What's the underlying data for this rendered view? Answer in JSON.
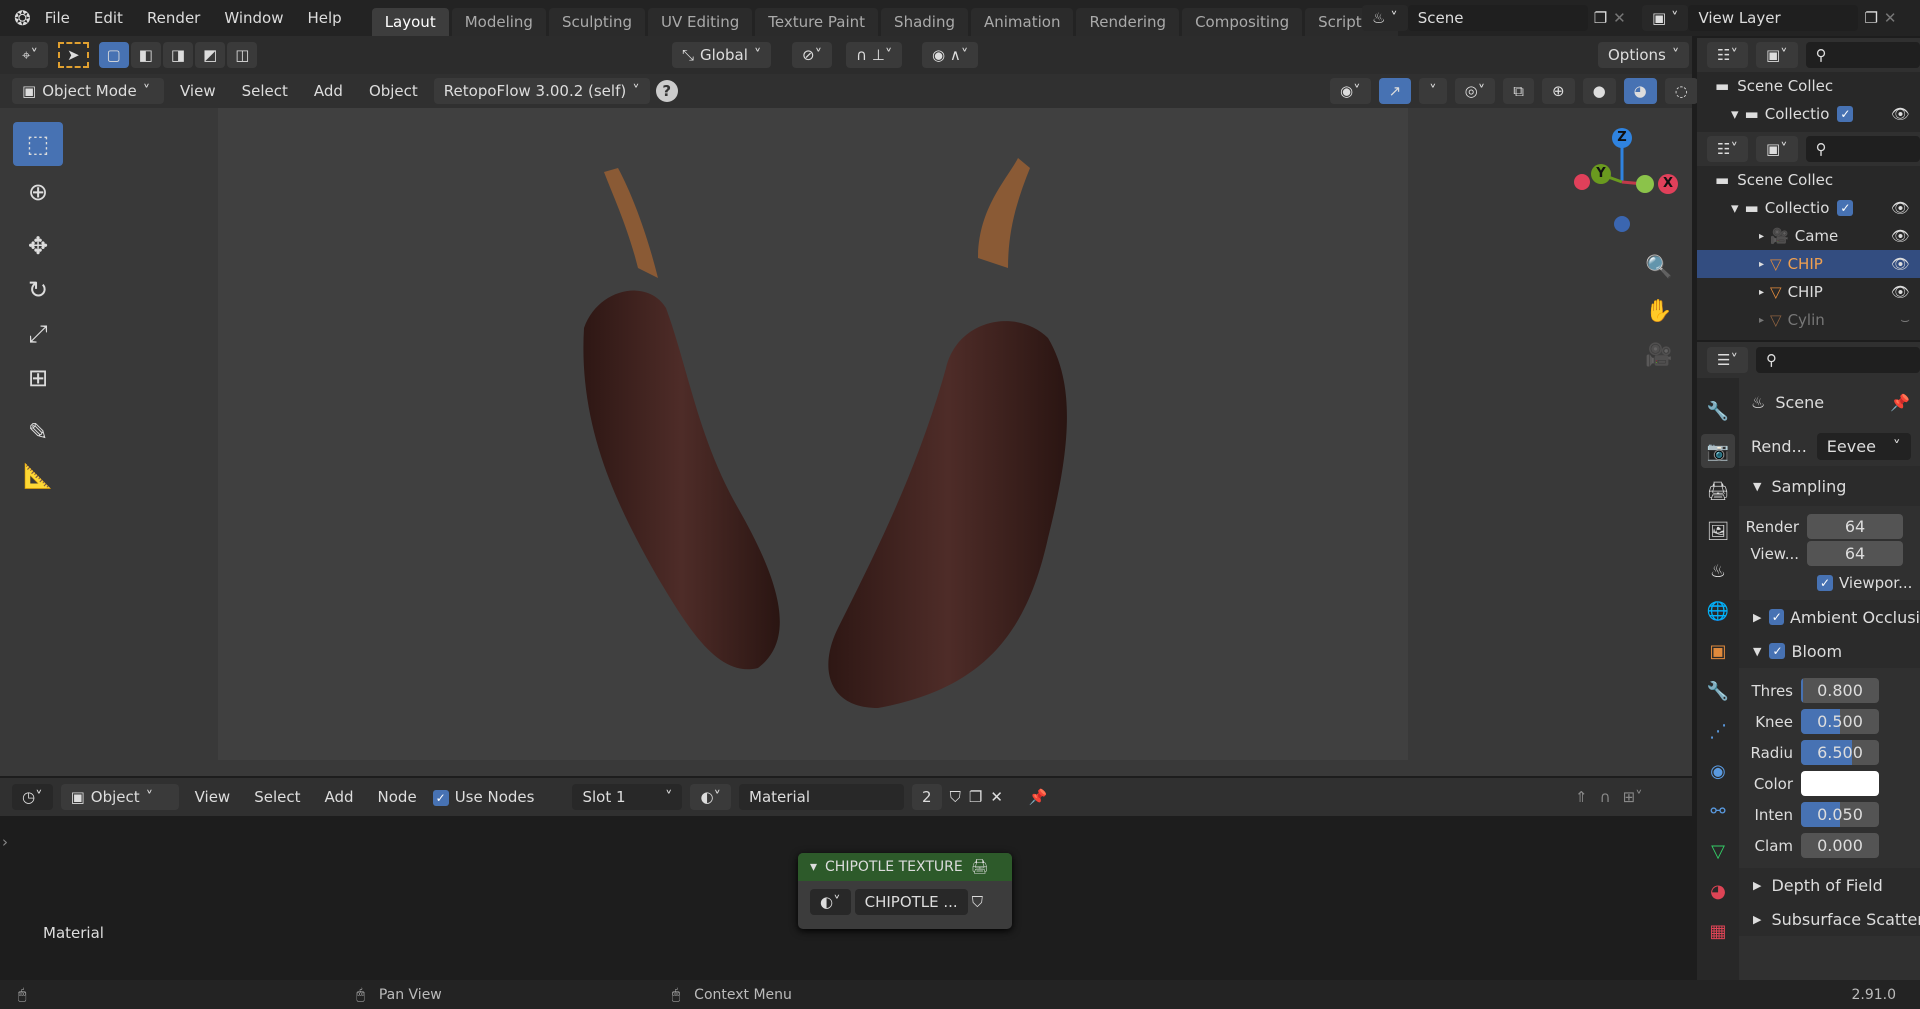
{
  "menu": {
    "items": [
      "File",
      "Edit",
      "Render",
      "Window",
      "Help"
    ]
  },
  "workspaces": [
    "Layout",
    "Modeling",
    "Sculpting",
    "UV Editing",
    "Texture Paint",
    "Shading",
    "Animation",
    "Rendering",
    "Compositing",
    "Scripting"
  ],
  "add_tab": "+",
  "scene": {
    "name": "Scene",
    "view_layer": "View Layer"
  },
  "tool_header": {
    "orientation": "Global",
    "options": "Options"
  },
  "viewport_header": {
    "mode": "Object Mode",
    "menus": [
      "View",
      "Select",
      "Add",
      "Object"
    ],
    "addon": "RetopoFlow 3.00.2 (self)",
    "help": "?"
  },
  "gizmo": {
    "z": "Z",
    "y": "Y",
    "x": "X"
  },
  "outliner": {
    "top": {
      "root": "Scene Collec",
      "collection": "Collectio"
    },
    "bottom": {
      "root": "Scene Collec",
      "collection": "Collectio",
      "items": [
        {
          "name": "Came",
          "type": "camera"
        },
        {
          "name": "CHIP",
          "type": "mesh",
          "selected": true
        },
        {
          "name": "CHIP",
          "type": "mesh"
        },
        {
          "name": "Cylin",
          "type": "mesh",
          "hidden": true
        }
      ]
    }
  },
  "properties": {
    "context": "Scene",
    "render_engine_label": "Rend...",
    "render_engine": "Eevee",
    "sampling": {
      "title": "Sampling",
      "render_label": "Render",
      "render": "64",
      "viewport_label": "View...",
      "viewport": "64",
      "denoise_label": "Viewpor..."
    },
    "ambient_occlusion": "Ambient Occlusi",
    "bloom": {
      "title": "Bloom",
      "fields": [
        {
          "label": "Thres",
          "value": "0.800",
          "fill": 0.03
        },
        {
          "label": "Knee",
          "value": "0.500",
          "fill": 0.5
        },
        {
          "label": "Radiu",
          "value": "6.500",
          "fill": 0.65
        },
        {
          "label": "Inten",
          "value": "0.050",
          "fill": 0.5
        },
        {
          "label": "Clam",
          "value": "0.000",
          "fill": 0
        }
      ],
      "color_label": "Color",
      "color": "#ffffff"
    },
    "depth_of_field": "Depth of Field",
    "subsurface": "Subsurface Scatteri"
  },
  "node_header": {
    "editor": "Object",
    "menus": [
      "View",
      "Select",
      "Add",
      "Node"
    ],
    "use_nodes": "Use Nodes",
    "slot": "Slot 1",
    "material": "Material",
    "users": "2"
  },
  "node": {
    "title": "CHIPOTLE TEXTURE",
    "material": "CHIPOTLE ..."
  },
  "node_area_label": "Material",
  "status": {
    "pan": "Pan View",
    "context": "Context Menu",
    "version": "2.91.0"
  }
}
